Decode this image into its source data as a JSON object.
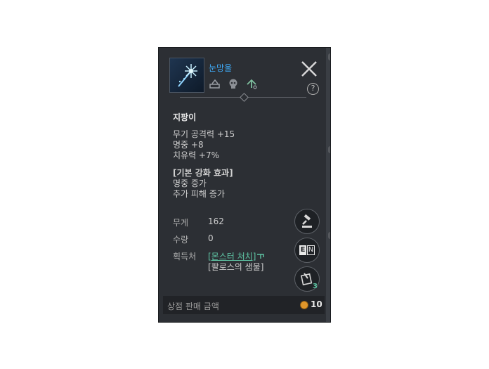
{
  "item": {
    "name": "눈망울",
    "type": "지팡이",
    "stats": [
      "무기 공격력 +15",
      "명중 +8",
      "치유력 +7%"
    ],
    "enhance_title": "[기본 강화 효과]",
    "enhance_effects": [
      "명중 증가",
      "추가 피해 증가"
    ]
  },
  "info": {
    "weight_label": "무게",
    "weight_value": "162",
    "quantity_label": "수량",
    "quantity_value": "0",
    "source_label": "획득처",
    "source_link": "[몬스터 처치]",
    "source_other": "[팔로스의 샘물]"
  },
  "buttons": {
    "help": "?",
    "compare_count": "3",
    "lang_e": "E",
    "lang_n": "N"
  },
  "sell": {
    "label": "상점 판매 금액",
    "value": "10"
  },
  "colors": {
    "item_name": "#3fa9f5",
    "link": "#5fc6a5",
    "coin": "#e0962a"
  },
  "icons": [
    "snowflake-staff-icon",
    "close-icon",
    "help-icon",
    "tradeable-icon",
    "skull-icon",
    "upgrade-icon",
    "auction-icon",
    "translate-icon",
    "compare-icon",
    "link-arrow-icon",
    "coin-icon"
  ]
}
